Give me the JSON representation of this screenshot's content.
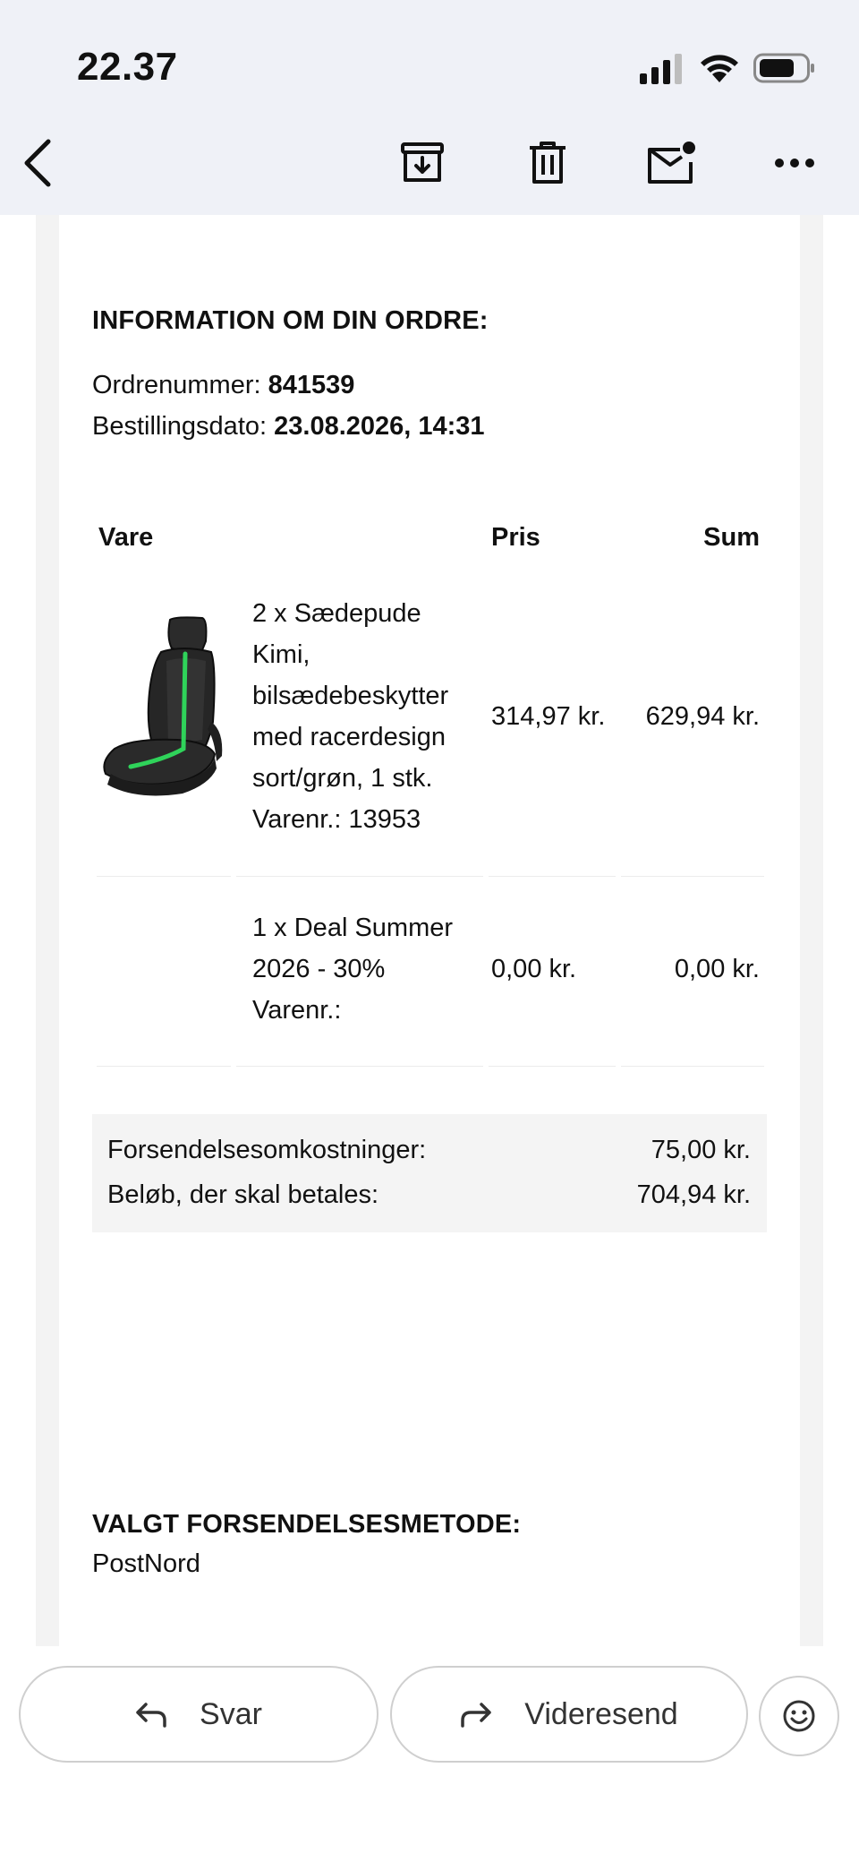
{
  "status_bar": {
    "time": "22.37"
  },
  "toolbar": {
    "icons": [
      "back-arrow-icon",
      "archive-icon",
      "trash-icon",
      "mark-unread-icon",
      "more-icon"
    ]
  },
  "order": {
    "section_title": "INFORMATION OM DIN ORDRE:",
    "order_number_label": "Ordrenummer:",
    "order_number": "841539",
    "order_date_label": "Bestillingsdato:",
    "order_date": "23.08.2026, 14:31"
  },
  "table": {
    "headers": {
      "item": "Vare",
      "price": "Pris",
      "sum": "Sum"
    },
    "rows": [
      {
        "lines": [
          "2 x Sædepude",
          "Kimi,",
          "bilsædebeskytter",
          "med racerdesign",
          "sort/grøn, 1 stk.",
          "Varenr.: 13953"
        ],
        "price": "314,97 kr.",
        "sum": "629,94 kr.",
        "image": "black-green-car-seat-cover"
      },
      {
        "lines": [
          "1 x Deal Summer",
          "2026 - 30%",
          "Varenr.:"
        ],
        "price": "0,00 kr.",
        "sum": "0,00 kr."
      }
    ]
  },
  "summary": {
    "shipping_label": "Forsendelsesomkostninger:",
    "shipping_value": "75,00 kr.",
    "total_label": "Beløb, der skal betales:",
    "total_value": "704,94 kr."
  },
  "shipping": {
    "title": "VALGT FORSENDELSESMETODE:",
    "method": "PostNord"
  },
  "actions": {
    "reply_label": "Svar",
    "forward_label": "Videresend"
  },
  "colors": {
    "toolbar_bg": "#eff1f7",
    "seat_stripe": "#2fd35a"
  }
}
